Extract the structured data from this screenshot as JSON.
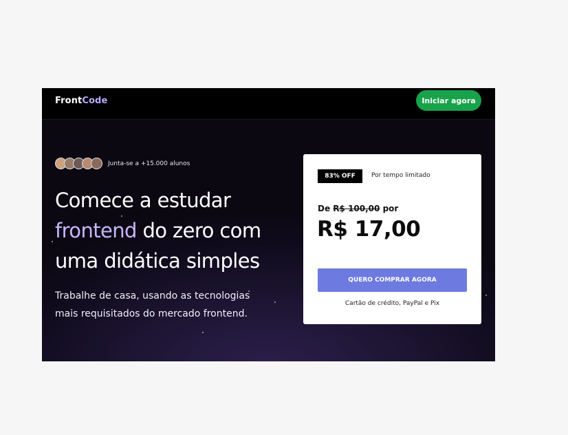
{
  "header": {
    "logo_part1": "Front",
    "logo_part2": "Code",
    "cta_label": "Iniciar agora"
  },
  "hero": {
    "join_text": "Junta-se a +15.000 alunos",
    "avatars": [
      "#c9a27d",
      "#9a7a66",
      "#6d5a57",
      "#b88a72",
      "#8a6a5c"
    ],
    "headline_line1": "Comece a estudar",
    "headline_highlight": "frontend",
    "headline_line2_rest": "do zero com",
    "headline_line3": "uma didática simples",
    "subtitle": "Trabalhe de casa, usando as tecnologias mais requisitados do mercado frontend."
  },
  "offer": {
    "badge": "83% OFF",
    "limited": "Por tempo limitado",
    "from_prefix": "De",
    "old_price": "R$ 100,00",
    "from_suffix": "por",
    "price": "R$ 17,00",
    "buy_label": "QUERO COMPRAR AGORA",
    "payment": "Cartão de crédito, PayPal e Pix"
  },
  "colors": {
    "accent_purple": "#c6b6ff",
    "cta_green": "#18a24a",
    "buy_blue": "#6d7ae0"
  }
}
